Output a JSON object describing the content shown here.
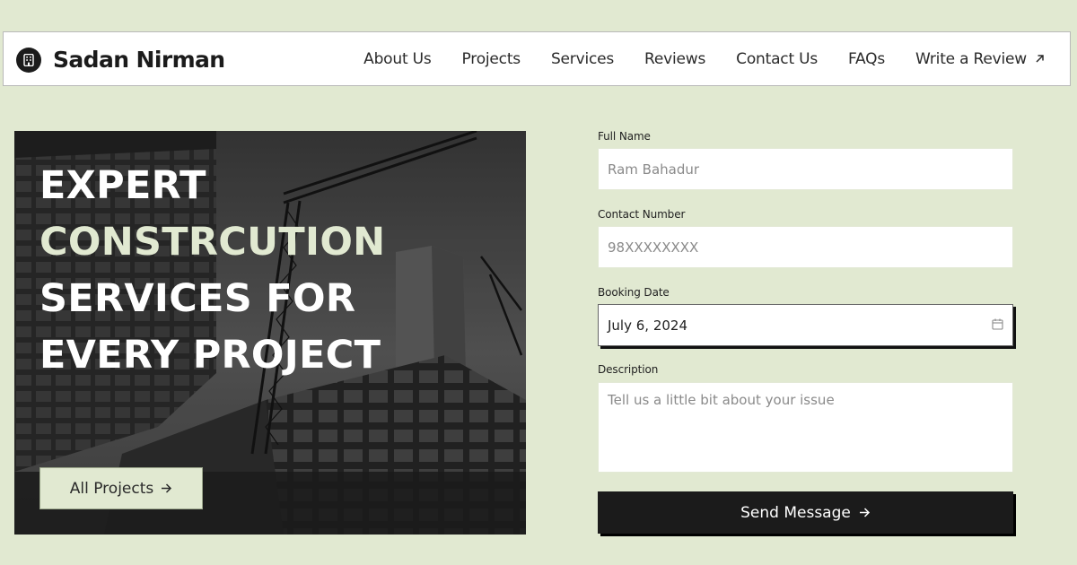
{
  "nav": {
    "brand_name": "Sadan Nirman",
    "brand_icon": "building-icon",
    "links": [
      {
        "label": "About Us"
      },
      {
        "label": "Projects"
      },
      {
        "label": "Services"
      },
      {
        "label": "Reviews"
      },
      {
        "label": "Contact Us"
      },
      {
        "label": "FAQs"
      },
      {
        "label": "Write a Review",
        "icon": "arrow-up-right-icon"
      }
    ]
  },
  "hero": {
    "title_lines": [
      "EXPERT",
      "CONSTRCUTION",
      "SERVICES FOR",
      "EVERY PROJECT"
    ],
    "button_label": "All Projects",
    "button_icon": "arrow-right-icon"
  },
  "form": {
    "full_name": {
      "label": "Full Name",
      "placeholder": "Ram Bahadur",
      "value": ""
    },
    "contact": {
      "label": "Contact Number",
      "placeholder": "98XXXXXXXX",
      "value": ""
    },
    "booking_date": {
      "label": "Booking Date",
      "value": "July 6, 2024",
      "icon": "calendar-icon"
    },
    "description": {
      "label": "Description",
      "placeholder": "Tell us a little bit about your issue",
      "value": ""
    },
    "submit_label": "Send Message",
    "submit_icon": "arrow-right-icon"
  },
  "colors": {
    "page_background": "#e1e9d1",
    "accent_text": "#e1e9d1",
    "dark": "#1b1b1b",
    "white": "#ffffff"
  }
}
